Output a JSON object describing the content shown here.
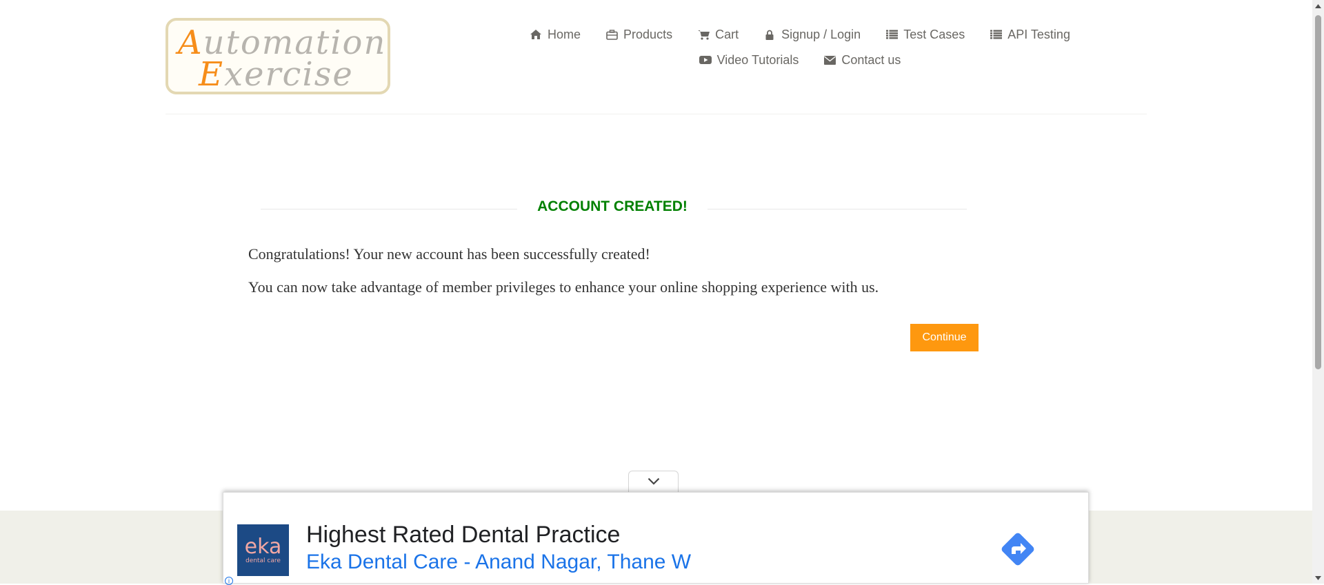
{
  "logo": {
    "line1_accent": "A",
    "line1_rest": "utomation",
    "line2_accent": "E",
    "line2_rest": "xercise"
  },
  "nav": {
    "row1": [
      {
        "icon": "home-icon",
        "label": "Home"
      },
      {
        "icon": "briefcase-icon",
        "label": "Products"
      },
      {
        "icon": "cart-icon",
        "label": "Cart"
      },
      {
        "icon": "lock-icon",
        "label": "Signup / Login"
      },
      {
        "icon": "list-icon",
        "label": "Test Cases"
      },
      {
        "icon": "list-icon",
        "label": "API Testing"
      }
    ],
    "row2": [
      {
        "icon": "youtube-play-icon",
        "label": "Video Tutorials"
      },
      {
        "icon": "envelope-icon",
        "label": "Contact us"
      }
    ]
  },
  "main": {
    "title": "ACCOUNT CREATED!",
    "message1": "Congratulations! Your new account has been successfully created!",
    "message2": "You can now take advantage of member privileges to enhance your online shopping experience with us.",
    "continue_label": "Continue"
  },
  "ad": {
    "logo_main": "eka",
    "logo_sub": "dental care",
    "headline": "Highest Rated Dental Practice",
    "subline": "Eka Dental Care - Anand Nagar, Thane W",
    "info": "i"
  },
  "colors": {
    "accent": "#fe980f",
    "success": "#008000",
    "nav_text": "#696763",
    "ad_link": "#1a73e8",
    "footer_bg": "#f0f0e9"
  }
}
